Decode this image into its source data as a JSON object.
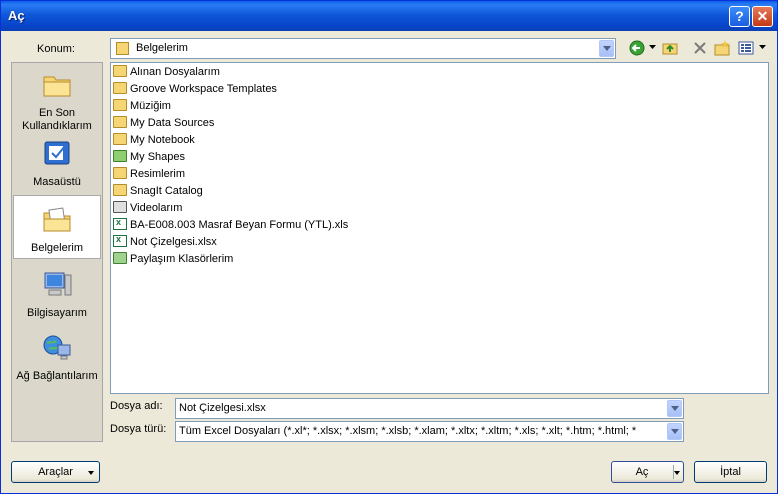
{
  "window": {
    "title": "Aç",
    "help_label": "?",
    "close_label": "✕"
  },
  "location": {
    "label": "Konum:",
    "value": "Belgelerim"
  },
  "toolbar": {
    "icons": [
      "back-icon",
      "up-folder-icon",
      "delete-icon",
      "new-folder-icon",
      "views-icon"
    ]
  },
  "places": [
    {
      "label": "En Son Kullandıklarım",
      "icon": "recent-folder-icon"
    },
    {
      "label": "Masaüstü",
      "icon": "desktop-icon"
    },
    {
      "label": "Belgelerim",
      "icon": "my-documents-icon",
      "selected": true
    },
    {
      "label": "Bilgisayarım",
      "icon": "my-computer-icon"
    },
    {
      "label": "Ağ Bağlantılarım",
      "icon": "network-icon"
    }
  ],
  "files": [
    {
      "name": "Alınan Dosyalarım",
      "type": "folder"
    },
    {
      "name": "Groove Workspace Templates",
      "type": "folder"
    },
    {
      "name": "Müziğim",
      "type": "folder"
    },
    {
      "name": "My Data Sources",
      "type": "folder"
    },
    {
      "name": "My Notebook",
      "type": "folder"
    },
    {
      "name": "My Shapes",
      "type": "folder"
    },
    {
      "name": "Resimlerim",
      "type": "folder"
    },
    {
      "name": "SnagIt Catalog",
      "type": "folder"
    },
    {
      "name": "Videolarım",
      "type": "folder"
    },
    {
      "name": "BA-E008.003 Masraf Beyan Formu (YTL).xls",
      "type": "xls"
    },
    {
      "name": "Not Çizelgesi.xlsx",
      "type": "xls"
    },
    {
      "name": "Paylaşım Klasörlerim",
      "type": "folder"
    }
  ],
  "filename": {
    "label": "Dosya adı:",
    "value": "Not Çizelgesi.xlsx"
  },
  "filetype": {
    "label": "Dosya türü:",
    "value": "Tüm Excel Dosyaları (*.xl*; *.xlsx; *.xlsm; *.xlsb; *.xlam; *.xltx; *.xltm; *.xls; *.xlt; *.htm; *.html; *"
  },
  "buttons": {
    "tools": "Araçlar",
    "open": "Aç",
    "cancel": "İptal"
  }
}
